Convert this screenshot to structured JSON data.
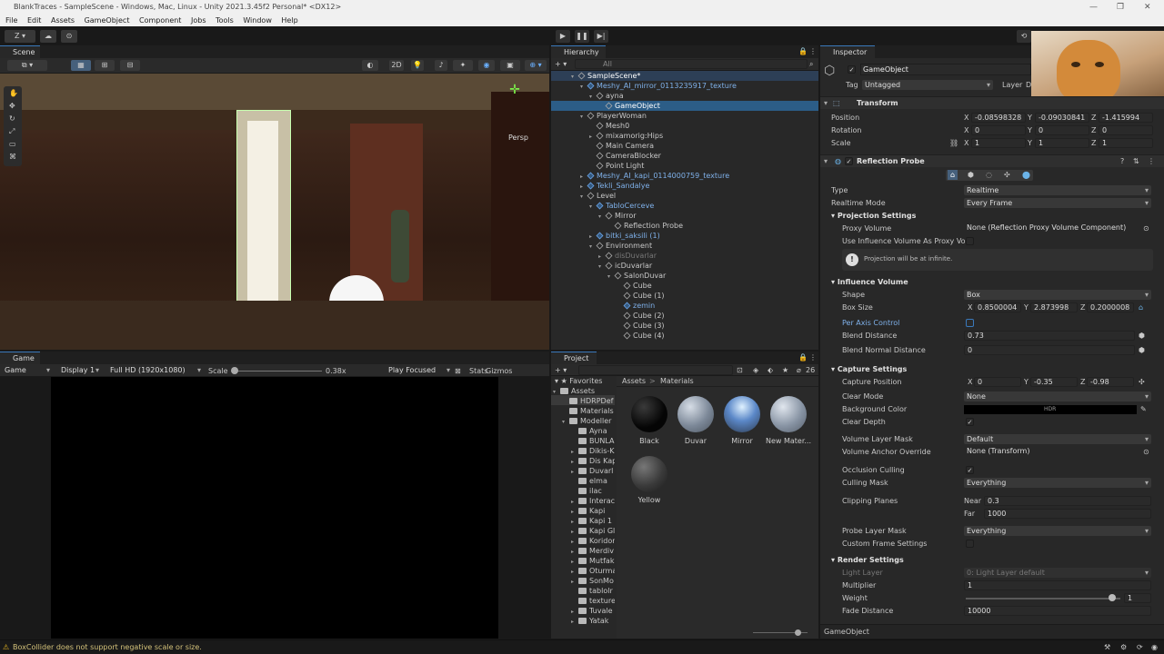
{
  "window": {
    "title": "BlankTraces - SampleScene - Windows, Mac, Linux - Unity 2021.3.45f2 Personal* <DX12>"
  },
  "menu": [
    "File",
    "Edit",
    "Assets",
    "GameObject",
    "Component",
    "Jobs",
    "Tools",
    "Window",
    "Help"
  ],
  "toolbar": {
    "account": "Z ▾"
  },
  "scene": {
    "tab": "Scene",
    "persp": "Persp",
    "mode2d": "2D"
  },
  "hierarchy": {
    "tab": "Hierarchy",
    "search": "All",
    "items": [
      {
        "label": "SampleScene*",
        "depth": 0,
        "type": "scene",
        "arrow": "▾",
        "style": "sel"
      },
      {
        "label": "Meshy_AI_mirror_0113235917_texture",
        "depth": 1,
        "type": "prefab",
        "arrow": "▾",
        "style": "blue"
      },
      {
        "label": "ayna",
        "depth": 2,
        "type": "obj",
        "arrow": "▾",
        "style": ""
      },
      {
        "label": "GameObject",
        "depth": 3,
        "type": "obj",
        "arrow": "",
        "style": "sel"
      },
      {
        "label": "PlayerWoman",
        "depth": 1,
        "type": "obj",
        "arrow": "▾",
        "style": ""
      },
      {
        "label": "Mesh0",
        "depth": 2,
        "type": "obj",
        "arrow": "",
        "style": ""
      },
      {
        "label": "mixamorig:Hips",
        "depth": 2,
        "type": "obj",
        "arrow": "▸",
        "style": ""
      },
      {
        "label": "Main Camera",
        "depth": 2,
        "type": "obj",
        "arrow": "",
        "style": ""
      },
      {
        "label": "CameraBlocker",
        "depth": 2,
        "type": "obj",
        "arrow": "",
        "style": ""
      },
      {
        "label": "Point Light",
        "depth": 2,
        "type": "obj",
        "arrow": "",
        "style": ""
      },
      {
        "label": "Meshy_AI_kapi_0114000759_texture",
        "depth": 1,
        "type": "prefab",
        "arrow": "▸",
        "style": "blue"
      },
      {
        "label": "Tekli_Sandalye",
        "depth": 1,
        "type": "prefab",
        "arrow": "▸",
        "style": "blue"
      },
      {
        "label": "Level",
        "depth": 1,
        "type": "obj",
        "arrow": "▾",
        "style": ""
      },
      {
        "label": "TabloCerceve",
        "depth": 2,
        "type": "prefab",
        "arrow": "▾",
        "style": "blue"
      },
      {
        "label": "Mirror",
        "depth": 3,
        "type": "obj",
        "arrow": "▾",
        "style": ""
      },
      {
        "label": "Reflection Probe",
        "depth": 4,
        "type": "obj",
        "arrow": "",
        "style": ""
      },
      {
        "label": "bitki_saksili (1)",
        "depth": 2,
        "type": "prefab",
        "arrow": "▸",
        "style": "blue"
      },
      {
        "label": "Environment",
        "depth": 2,
        "type": "obj",
        "arrow": "▾",
        "style": ""
      },
      {
        "label": "disDuvarlar",
        "depth": 3,
        "type": "obj",
        "arrow": "▸",
        "style": "dim"
      },
      {
        "label": "icDuvarlar",
        "depth": 3,
        "type": "obj",
        "arrow": "▾",
        "style": ""
      },
      {
        "label": "SalonDuvar",
        "depth": 4,
        "type": "obj",
        "arrow": "▾",
        "style": ""
      },
      {
        "label": "Cube",
        "depth": 5,
        "type": "obj",
        "arrow": "",
        "style": ""
      },
      {
        "label": "Cube (1)",
        "depth": 5,
        "type": "obj",
        "arrow": "",
        "style": ""
      },
      {
        "label": "zemin",
        "depth": 5,
        "type": "prefab",
        "arrow": "",
        "style": "blue"
      },
      {
        "label": "Cube (2)",
        "depth": 5,
        "type": "obj",
        "arrow": "",
        "style": ""
      },
      {
        "label": "Cube (3)",
        "depth": 5,
        "type": "obj",
        "arrow": "",
        "style": ""
      },
      {
        "label": "Cube (4)",
        "depth": 5,
        "type": "obj",
        "arrow": "",
        "style": ""
      }
    ]
  },
  "game": {
    "tab": "Game",
    "mode": "Game",
    "display": "Display 1",
    "resolution": "Full HD (1920x1080)",
    "scale_label": "Scale",
    "scale_value": "0.38x",
    "play_mode": "Play Focused",
    "stats": "Stats",
    "gizmos": "Gizmos"
  },
  "project": {
    "tab": "Project",
    "badge": "26",
    "favorites": "Favorites",
    "breadcrumb_root": "Assets",
    "breadcrumb_sep": ">",
    "breadcrumb_leaf": "Materials",
    "tree": [
      {
        "label": "Assets",
        "depth": 0,
        "arrow": "▾"
      },
      {
        "label": "HDRPDef",
        "depth": 1,
        "arrow": ""
      },
      {
        "label": "Materials",
        "depth": 1,
        "arrow": ""
      },
      {
        "label": "Modeller",
        "depth": 1,
        "arrow": "▾"
      },
      {
        "label": "Ayna",
        "depth": 2,
        "arrow": ""
      },
      {
        "label": "BUNLA",
        "depth": 2,
        "arrow": ""
      },
      {
        "label": "Dikis-K",
        "depth": 2,
        "arrow": "▸"
      },
      {
        "label": "Dis Kap",
        "depth": 2,
        "arrow": "▸"
      },
      {
        "label": "Duvarl",
        "depth": 2,
        "arrow": "▸"
      },
      {
        "label": "elma",
        "depth": 2,
        "arrow": ""
      },
      {
        "label": "ilac",
        "depth": 2,
        "arrow": ""
      },
      {
        "label": "Interac",
        "depth": 2,
        "arrow": "▸"
      },
      {
        "label": "Kapi",
        "depth": 2,
        "arrow": "▸"
      },
      {
        "label": "Kapi 1",
        "depth": 2,
        "arrow": "▸"
      },
      {
        "label": "Kapi Gl",
        "depth": 2,
        "arrow": "▸"
      },
      {
        "label": "Koridor",
        "depth": 2,
        "arrow": "▸"
      },
      {
        "label": "Merdiv",
        "depth": 2,
        "arrow": "▸"
      },
      {
        "label": "Mutfak",
        "depth": 2,
        "arrow": "▸"
      },
      {
        "label": "Oturma",
        "depth": 2,
        "arrow": "▸"
      },
      {
        "label": "SonMo",
        "depth": 2,
        "arrow": "▸"
      },
      {
        "label": "tablolr",
        "depth": 2,
        "arrow": ""
      },
      {
        "label": "texture",
        "depth": 2,
        "arrow": ""
      },
      {
        "label": "Tuvale",
        "depth": 2,
        "arrow": "▸"
      },
      {
        "label": "Yatak",
        "depth": 2,
        "arrow": "▸"
      }
    ],
    "materials": [
      {
        "name": "Black",
        "color": "#0a0a0a"
      },
      {
        "name": "Duvar",
        "color": "#8a96a6"
      },
      {
        "name": "Mirror",
        "color": "#7aa0d8"
      },
      {
        "name": "New Mater...",
        "color": "#98a4b4"
      },
      {
        "name": "Yellow",
        "color": "#4a4a4a"
      }
    ]
  },
  "inspector": {
    "tab": "Inspector",
    "object_name": "GameObject",
    "tag_label": "Tag",
    "tag_value": "Untagged",
    "layer_label": "Layer",
    "layer_value": "D",
    "transform": {
      "title": "Transform",
      "position": {
        "label": "Position",
        "x": "-0.08598328",
        "y": "-0.09030841",
        "z": "-1.415994"
      },
      "rotation": {
        "label": "Rotation",
        "x": "0",
        "y": "0",
        "z": "0"
      },
      "scale": {
        "label": "Scale",
        "x": "1",
        "y": "1",
        "z": "1"
      }
    },
    "probe": {
      "title": "Reflection Probe",
      "type_label": "Type",
      "type_value": "Realtime",
      "mode_label": "Realtime Mode",
      "mode_value": "Every Frame",
      "projection_title": "Projection Settings",
      "proxy_label": "Proxy Volume",
      "proxy_value": "None (Reflection Proxy Volume Component)",
      "use_influence_label": "Use Influence Volume As Proxy Volu",
      "info": "Projection will be at infinite.",
      "influence_title": "Influence Volume",
      "shape_label": "Shape",
      "shape_value": "Box",
      "boxsize_label": "Box Size",
      "box_x": "0.8500004",
      "box_y": "2.873998",
      "box_z": "0.2000008",
      "per_axis_label": "Per Axis Control",
      "blend_label": "Blend Distance",
      "blend_value": "0.73",
      "blend_normal_label": "Blend Normal Distance",
      "blend_normal_value": "0",
      "capture_title": "Capture Settings",
      "capture_pos_label": "Capture Position",
      "cap_x": "0",
      "cap_y": "-0.35",
      "cap_z": "-0.98",
      "clear_mode_label": "Clear Mode",
      "clear_mode_value": "None",
      "bg_label": "Background Color",
      "bg_hdr": "HDR",
      "clear_depth_label": "Clear Depth",
      "vlm_label": "Volume Layer Mask",
      "vlm_value": "Default",
      "vao_label": "Volume Anchor Override",
      "vao_value": "None (Transform)",
      "occ_label": "Occlusion Culling",
      "cull_label": "Culling Mask",
      "cull_value": "Everything",
      "clip_label": "Clipping Planes",
      "near_label": "Near",
      "near_value": "0.3",
      "far_label": "Far",
      "far_value": "1000",
      "plm_label": "Probe Layer Mask",
      "plm_value": "Everything",
      "cfs_label": "Custom Frame Settings",
      "render_title": "Render Settings",
      "light_layer_label": "Light Layer",
      "light_layer_value": "0: Light Layer default",
      "multiplier_label": "Multiplier",
      "multiplier_value": "1",
      "weight_label": "Weight",
      "weight_value": "1",
      "weight_fraction": 0.97,
      "fade_label": "Fade Distance",
      "fade_value": "10000"
    },
    "footer": "GameObject"
  },
  "status": {
    "message": "BoxCollider does not support negative scale or size."
  },
  "icons": [
    "hand-icon",
    "move-icon",
    "rotate-icon",
    "scale-icon",
    "rect-icon",
    "transform-icon",
    "play-icon",
    "pause-icon",
    "step-icon",
    "history-icon",
    "cloud-icon",
    "lock-icon",
    "menu-icon",
    "plus-icon",
    "search-icon",
    "star-icon",
    "folder-icon",
    "help-icon",
    "preset-icon",
    "warning-icon",
    "gear-icon",
    "picker-icon"
  ]
}
